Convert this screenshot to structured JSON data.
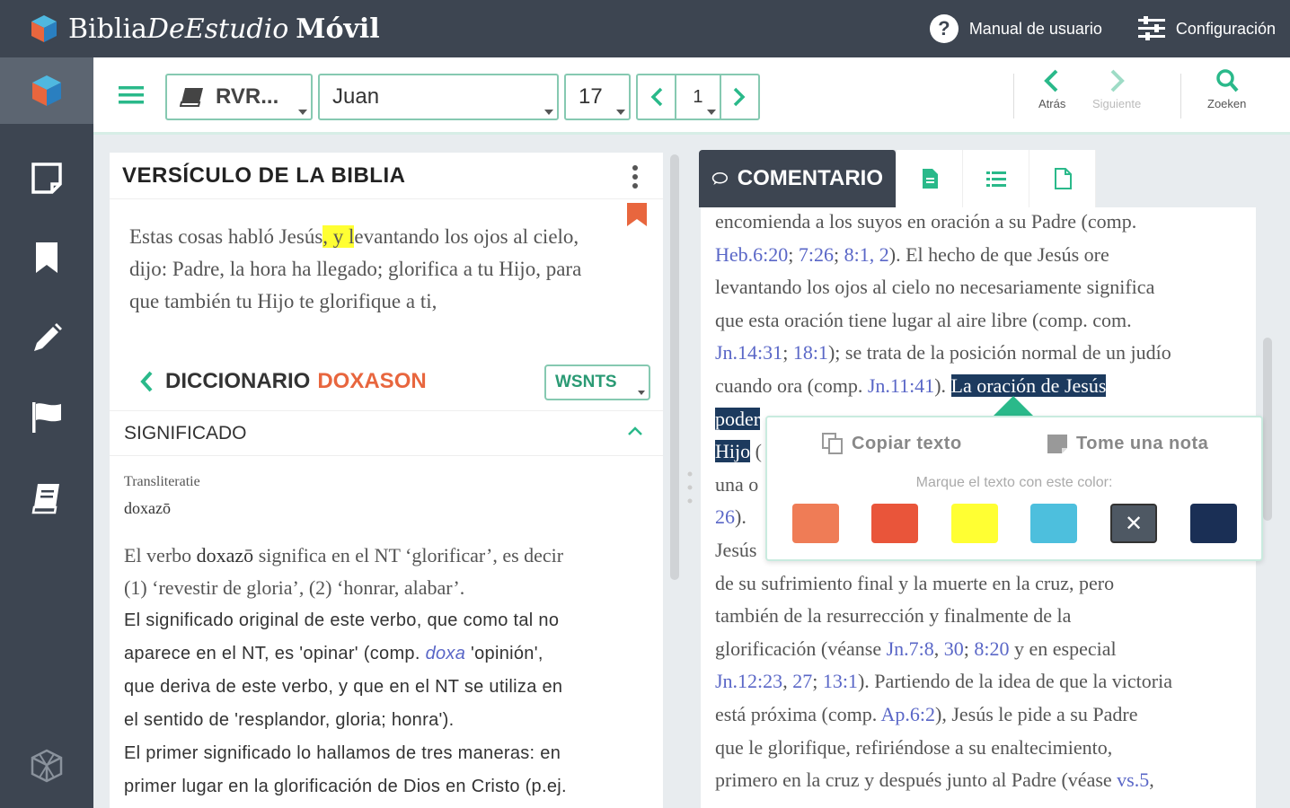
{
  "app": {
    "brand_part1": "Biblia",
    "brand_part2": "DeEstudio",
    "brand_part3": "Móvil",
    "manual_label": "Manual de usuario",
    "settings_label": "Configuración"
  },
  "toolbar": {
    "version": "RVR...",
    "book": "Juan",
    "chapter": "17",
    "verse": "1",
    "back_label": "Atrás",
    "next_label": "Siguiente",
    "search_label": "Zoeken"
  },
  "verse_panel": {
    "title": "VERSÍCULO DE LA BIBLIA",
    "text_before": "Estas cosas habló Jesús",
    "text_highlight": ", y l",
    "text_after_l1": "evantando los ojos al cielo,",
    "line2": "dijo: Padre, la hora ha llegado; glorifica a tu Hijo, para",
    "line3": "que también tu Hijo te glorifique a ti,"
  },
  "dictionary": {
    "label": "DICCIONARIO",
    "word": "DOXASON",
    "source": "WSNTS",
    "section": "SIGNIFICADO",
    "translit_label": "Transliteratie",
    "translit_value": "doxazō",
    "serif_l1_a": "El verbo ",
    "serif_l1_b": "doxazō",
    "serif_l1_c": " significa en el NT ‘glorificar’, es decir",
    "serif_l2": "(1) ‘revestir de gloria’, (2) ‘honrar, alabar’.",
    "sans_l1": "El significado original de este verbo, que como tal no",
    "sans_l2_a": "aparece en el NT, es 'opinar' (comp. ",
    "sans_l2_link": "doxa",
    "sans_l2_b": " 'opinión',",
    "sans_l3": "que deriva de este verbo, y que en el NT se utiliza en",
    "sans_l4": "el sentido de 'resplandor, gloria; honra').",
    "sans_l5": "El primer significado lo hallamos de tres maneras: en",
    "sans_l6": "primer lugar en la glorificación de Dios en Cristo (p.ej."
  },
  "commentary": {
    "tab_label": "COMENTARIO",
    "l0": "encomienda a los suyos en oración a su Padre (comp.",
    "l1_r1": "Heb.6:20",
    "l1_r2": "7:26",
    "l1_r3": "8:1, 2",
    "l1_t": "). El hecho de que Jesús ore",
    "l2": "levantando los ojos al cielo no necesariamente significa",
    "l3": "que esta oración tiene lugar al aire libre (comp. com.",
    "l4_r1": "Jn.14:31",
    "l4_r2": "18:1",
    "l4_t": "); se trata de la posición normal de un judío",
    "l5_t": "cuando ora (comp. ",
    "l5_r": "Jn.11:41",
    "l5_t2": "). ",
    "l5_sel": "La oración de Jesús",
    "l6_sel": "poder",
    "l7_sel": "Hijo",
    "l7_t": " (",
    "l8_t": "una o",
    "l9_r": "26",
    "l9_t": ").",
    "l10_t": "Jesús",
    "l11": "de su sufrimiento final y la muerte en la cruz, pero",
    "l12": "también de la resurrección y finalmente de la",
    "l13_t": "glorificación (véanse ",
    "l13_r1": "Jn.7:8",
    "l13_r2": "30",
    "l13_r3": "8:20",
    "l13_t2": " y en especial",
    "l14_r1": "Jn.12:23",
    "l14_r2": "27",
    "l14_r3": "13:1",
    "l14_t": "). Partiendo de la idea de que la victoria",
    "l15_t": "está próxima (comp. ",
    "l15_r": "Ap.6:2",
    "l15_t2": "), Jesús le pide a su Padre",
    "l16": "que le glorifique, refiriéndose a su enaltecimiento,",
    "l17_t": "primero en la cruz y después junto al Padre (véase ",
    "l17_r": "vs.5",
    "l17_t2": ","
  },
  "popup": {
    "copy_label": "Copiar texto",
    "note_label": "Tome una nota",
    "color_hint": "Marque el texto con este color:",
    "colors": [
      "#ef7c56",
      "#e9553a",
      "#ffff33",
      "#4dbfdd",
      "#4e5863",
      "#1a2f55"
    ],
    "clear_symbol": "✕"
  },
  "colors": {
    "accent": "#2ab98a",
    "dark": "#3d4551",
    "link": "#5a67c7",
    "dict_word": "#e8663e"
  }
}
